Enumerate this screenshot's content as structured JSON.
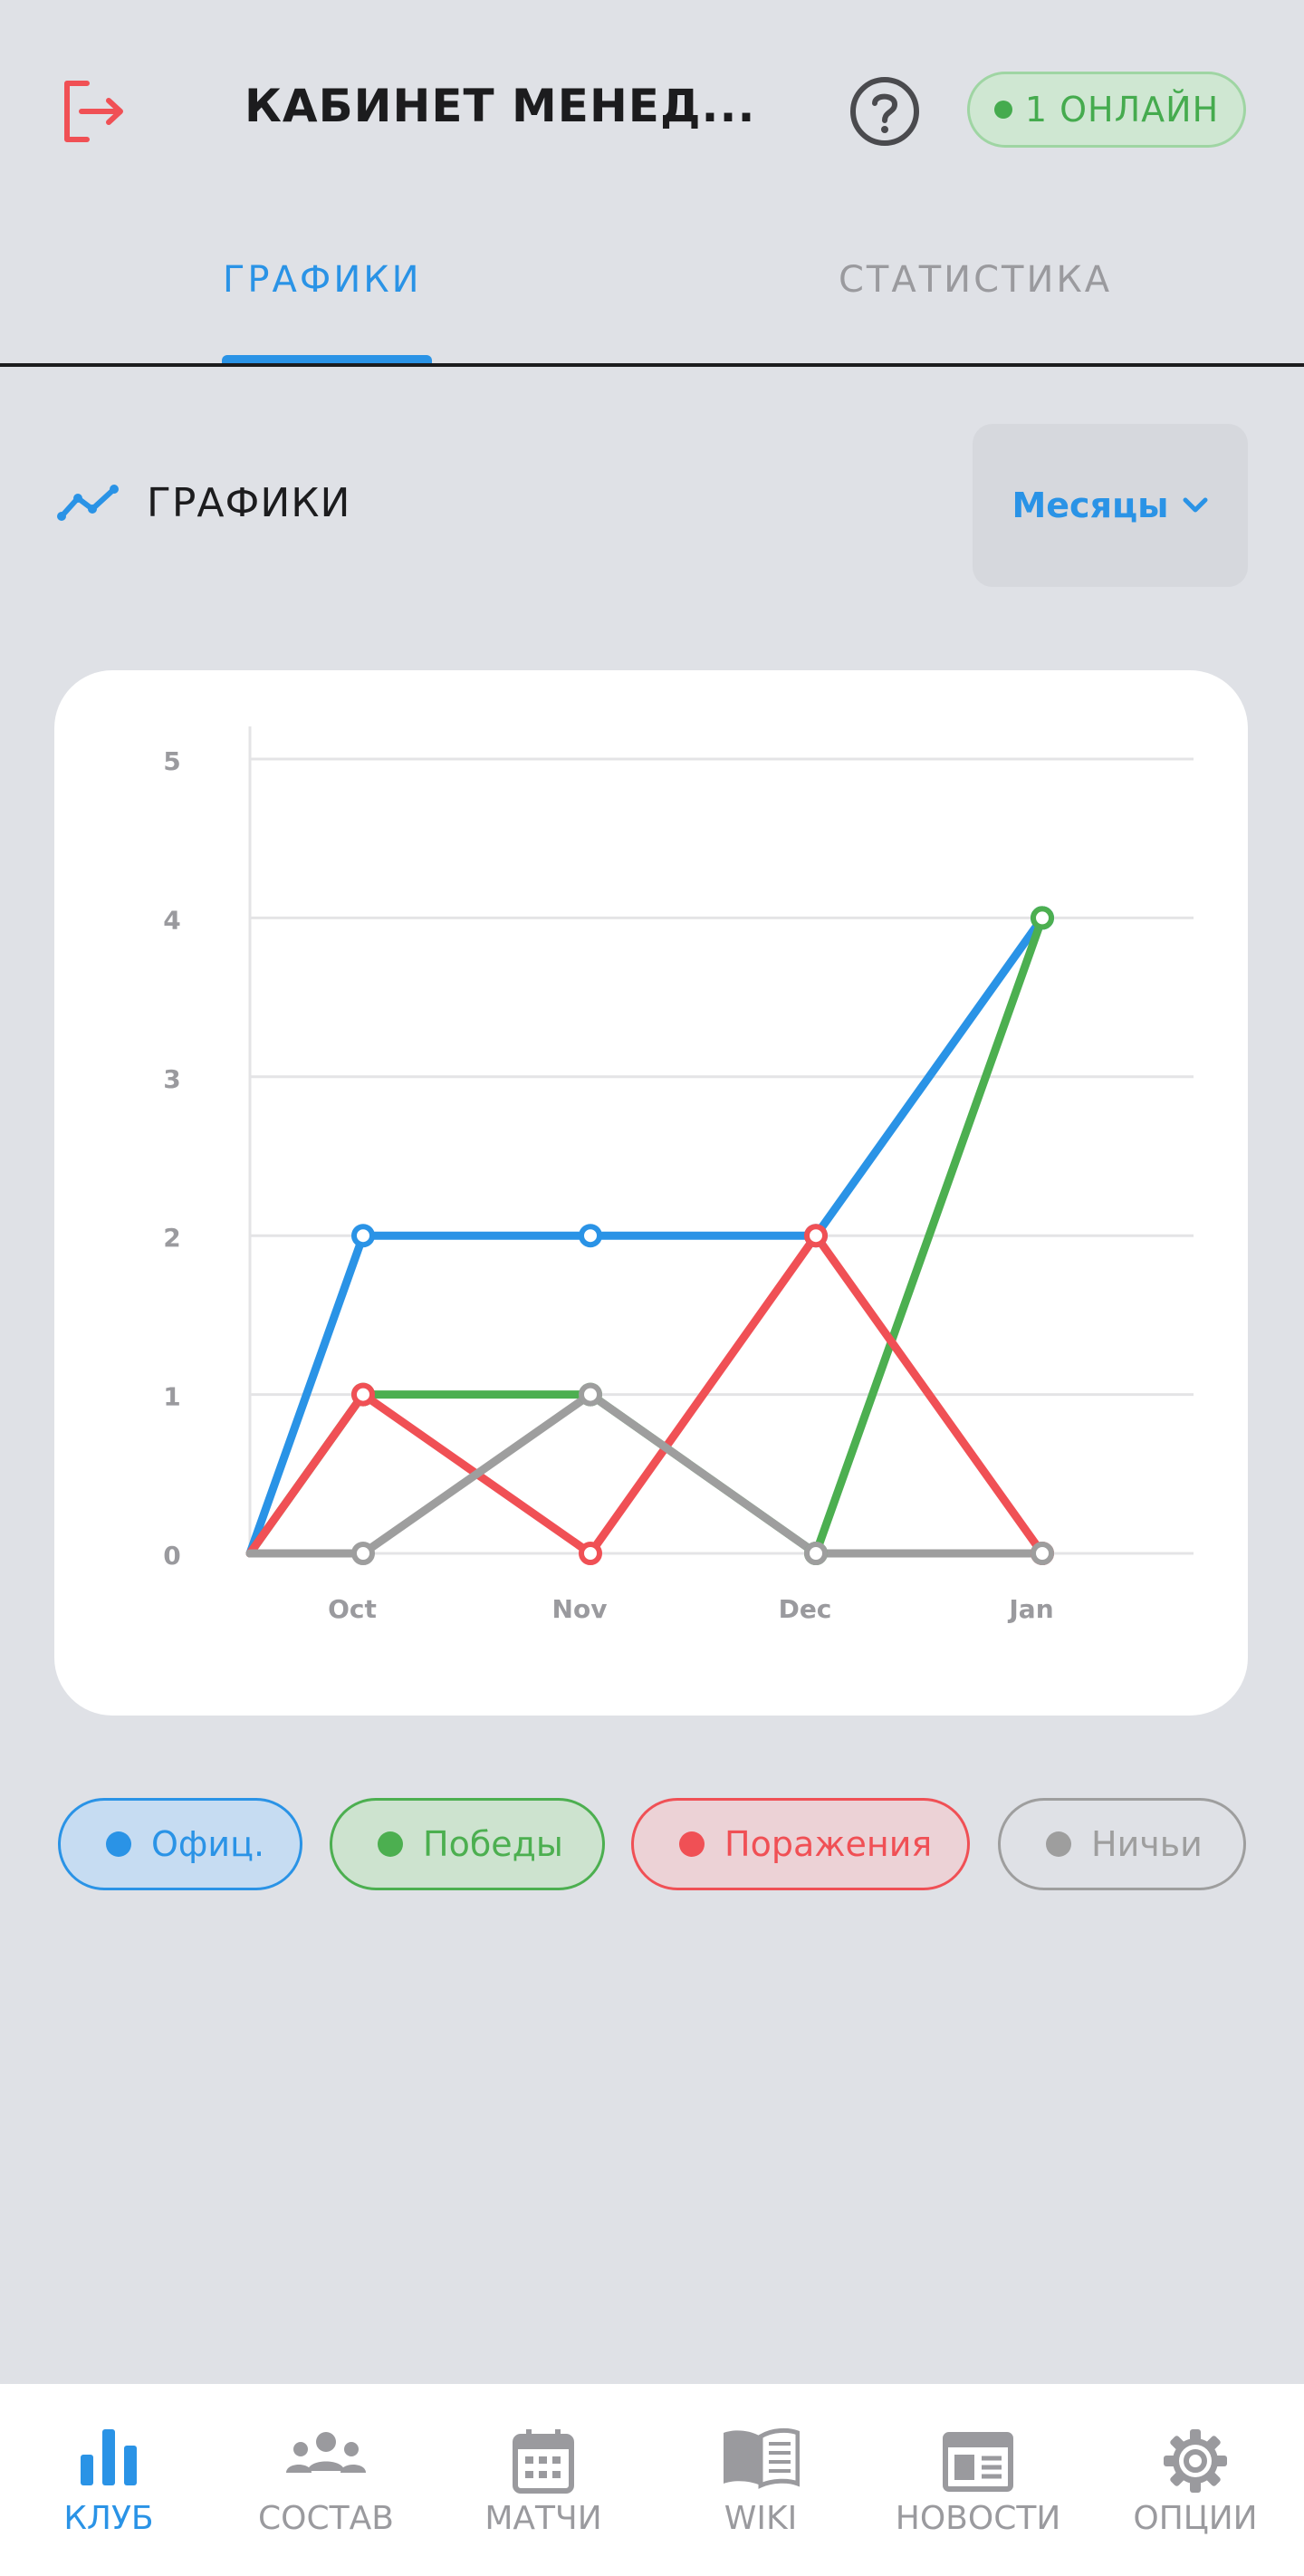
{
  "header": {
    "title": "КАБИНЕТ МЕНЕД...",
    "online_label": "1 ОНЛАЙН",
    "logout_icon": "logout-icon",
    "help_icon": "help-circle-icon"
  },
  "tabs": [
    {
      "label": "ГРАФИКИ",
      "active": true
    },
    {
      "label": "СТАТИСТИКА",
      "active": false
    }
  ],
  "section": {
    "title": "ГРАФИКИ",
    "icon": "line-chart-icon",
    "period_label": "Месяцы"
  },
  "chart_data": {
    "type": "line",
    "categories": [
      "",
      "Oct",
      "Nov",
      "Dec",
      "Jan"
    ],
    "ylim": [
      0,
      5
    ],
    "yticks": [
      "0",
      "1",
      "2",
      "3",
      "4",
      "5"
    ],
    "grid": true,
    "series": [
      {
        "name": "Офиц.",
        "color": "#2a93e6",
        "values": [
          0,
          2,
          2,
          2,
          4
        ]
      },
      {
        "name": "Победы",
        "color": "#4caf50",
        "values": [
          0,
          1,
          1,
          0,
          4
        ]
      },
      {
        "name": "Поражения",
        "color": "#f05055",
        "values": [
          0,
          1,
          0,
          2,
          0
        ]
      },
      {
        "name": "Ничьи",
        "color": "#9e9e9e",
        "values": [
          0,
          0,
          1,
          0,
          0
        ]
      }
    ]
  },
  "legend": [
    {
      "label": "Офиц.",
      "color": "#2a93e6",
      "bg": "#c6dcf2"
    },
    {
      "label": "Победы",
      "color": "#4caf50",
      "bg": "#cde3cf"
    },
    {
      "label": "Поражения",
      "color": "#f05055",
      "bg": "#ecd2d6"
    },
    {
      "label": "Ничьи",
      "color": "#9e9e9e",
      "bg": "#dfe1e6"
    }
  ],
  "nav": [
    {
      "label": "КЛУБ",
      "icon": "bar-chart-icon",
      "active": true
    },
    {
      "label": "СОСТАВ",
      "icon": "team-icon",
      "active": false
    },
    {
      "label": "МАТЧИ",
      "icon": "calendar-icon",
      "active": false
    },
    {
      "label": "WIKI",
      "icon": "book-icon",
      "active": false
    },
    {
      "label": "НОВОСТИ",
      "icon": "newspaper-icon",
      "active": false
    },
    {
      "label": "ОПЦИИ",
      "icon": "gear-icon",
      "active": false
    }
  ]
}
